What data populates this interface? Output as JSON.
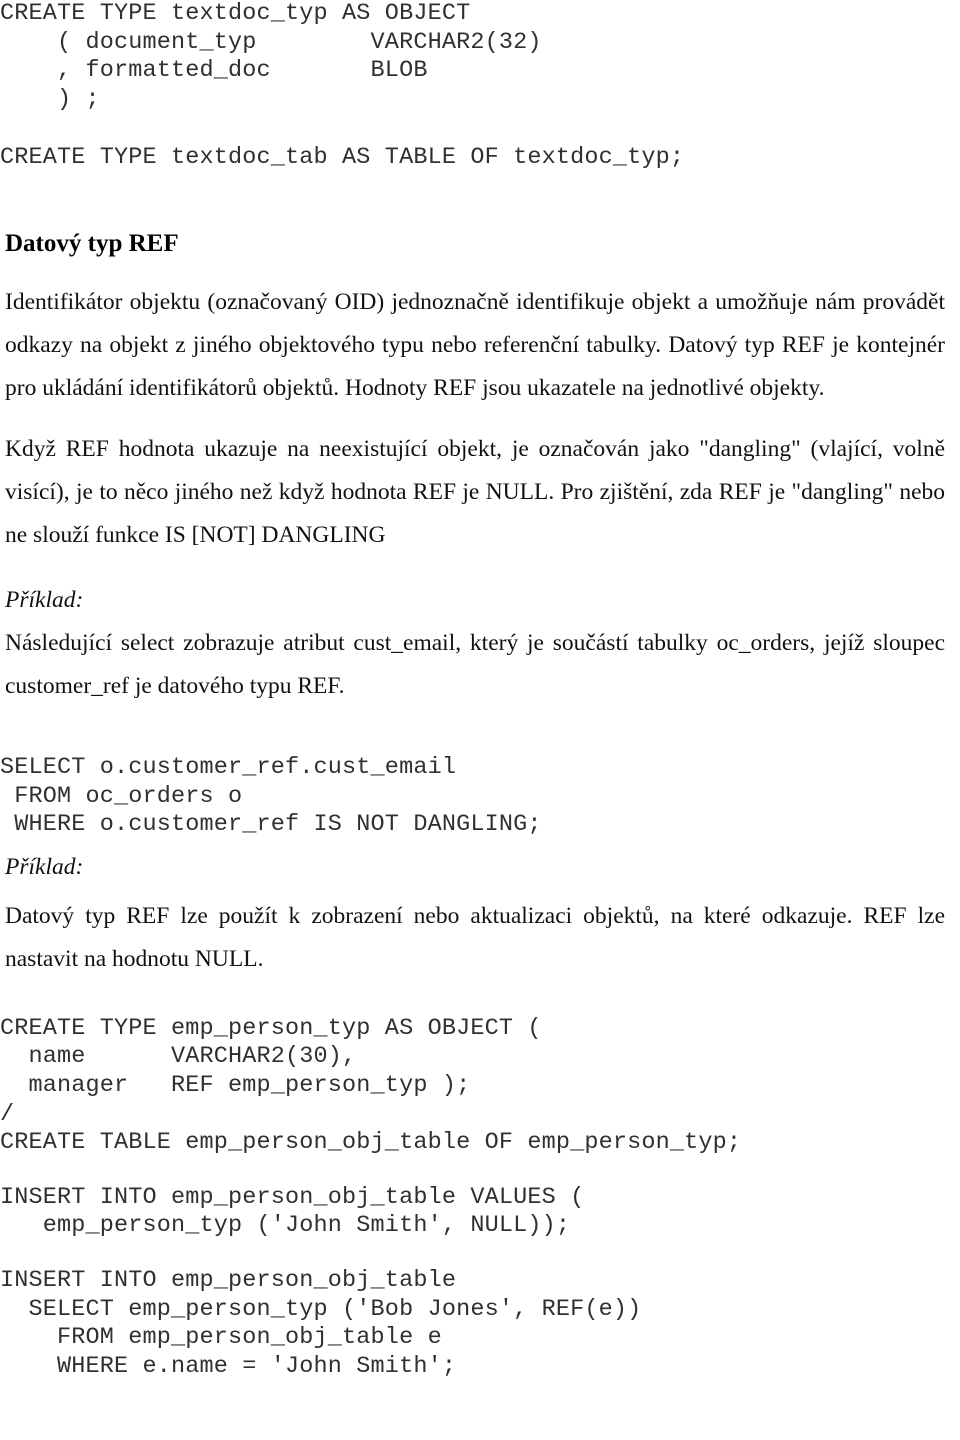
{
  "document": {
    "language": "cs",
    "sections": {
      "code_block_1": "CREATE TYPE textdoc_typ AS OBJECT\n    ( document_typ        VARCHAR2(32)\n    , formatted_doc       BLOB\n    ) ;",
      "code_block_2": "CREATE TYPE textdoc_tab AS TABLE OF textdoc_typ;",
      "heading_ref": "Datový typ REF",
      "para_oid": "Identifikátor objektu (označovaný OID) jednoznačně identifikuje objekt a umožňuje nám provádět odkazy na objekt z jiného objektového typu nebo referenční tabulky. Datový typ REF je kontejnér pro ukládání identifikátorů objektů. Hodnoty REF jsou ukazatele na jednotlivé objekty.",
      "para_dangling": "Když REF hodnota ukazuje na neexistující objekt, je označován jako \"dangling\" (vlající, volně visící), je to něco jiného než když hodnota REF je NULL. Pro zjištění, zda REF je \"dangling\"  nebo ne slouží funkce IS [NOT] DANGLING",
      "label_example_1": "Příklad:",
      "para_select_desc": "Následující select zobrazuje atribut cust_email, který je součástí tabulky oc_orders, jejíž sloupec customer_ref je datového typu REF.",
      "code_block_3": "SELECT o.customer_ref.cust_email\n FROM oc_orders o\n WHERE o.customer_ref IS NOT DANGLING;",
      "label_example_2": "Příklad:",
      "para_ref_usage": "Datový typ REF lze použít k zobrazení nebo aktualizaci objektů, na které odkazuje. REF lze nastavit na hodnotu NULL.",
      "code_block_4": "CREATE TYPE emp_person_typ AS OBJECT (\n  name      VARCHAR2(30),\n  manager   REF emp_person_typ );\n/\nCREATE TABLE emp_person_obj_table OF emp_person_typ;",
      "code_block_5": "INSERT INTO emp_person_obj_table VALUES (\n   emp_person_typ ('John Smith', NULL));",
      "code_block_6": "INSERT INTO emp_person_obj_table\n  SELECT emp_person_typ ('Bob Jones', REF(e))\n    FROM emp_person_obj_table e\n    WHERE e.name = 'John Smith';"
    },
    "colors": {
      "page_background": "#ffffff",
      "body_text": "#111111",
      "code_text": "#303030",
      "heading_text": "#000000"
    }
  }
}
